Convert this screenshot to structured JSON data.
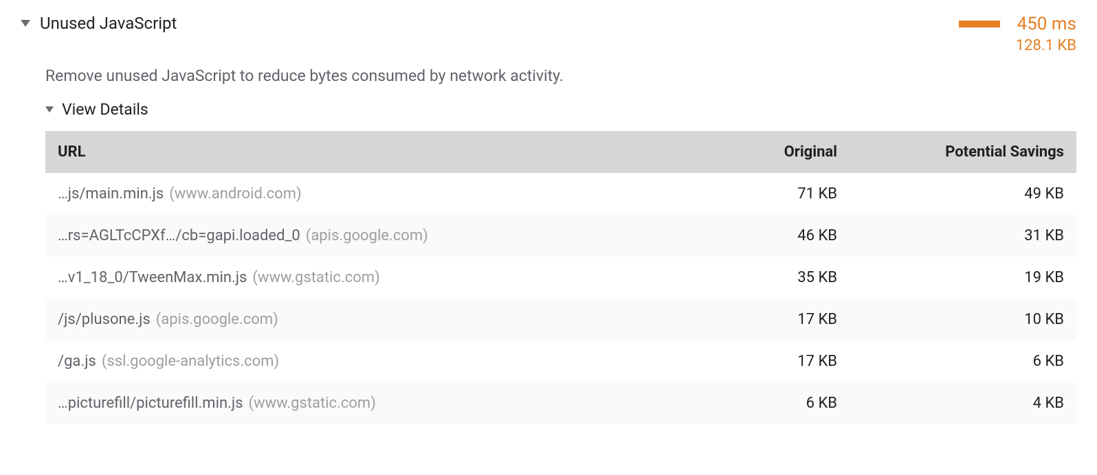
{
  "audit": {
    "title": "Unused JavaScript",
    "description": "Remove unused JavaScript to reduce bytes consumed by network activity.",
    "time_savings": "450 ms",
    "size_savings": "128.1 KB",
    "details_label": "View Details"
  },
  "table": {
    "headers": {
      "url": "URL",
      "original": "Original",
      "savings": "Potential Savings"
    },
    "rows": [
      {
        "path": "…js/main.min.js",
        "domain": "(www.android.com)",
        "original": "71 KB",
        "savings": "49 KB"
      },
      {
        "path": "…rs=AGLTcCPXf…/cb=gapi.loaded_0",
        "domain": "(apis.google.com)",
        "original": "46 KB",
        "savings": "31 KB"
      },
      {
        "path": "…v1_18_0/TweenMax.min.js",
        "domain": "(www.gstatic.com)",
        "original": "35 KB",
        "savings": "19 KB"
      },
      {
        "path": "/js/plusone.js",
        "domain": "(apis.google.com)",
        "original": "17 KB",
        "savings": "10 KB"
      },
      {
        "path": "/ga.js",
        "domain": "(ssl.google-analytics.com)",
        "original": "17 KB",
        "savings": "6 KB"
      },
      {
        "path": "…picturefill/picturefill.min.js",
        "domain": "(www.gstatic.com)",
        "original": "6 KB",
        "savings": "4 KB"
      }
    ]
  }
}
